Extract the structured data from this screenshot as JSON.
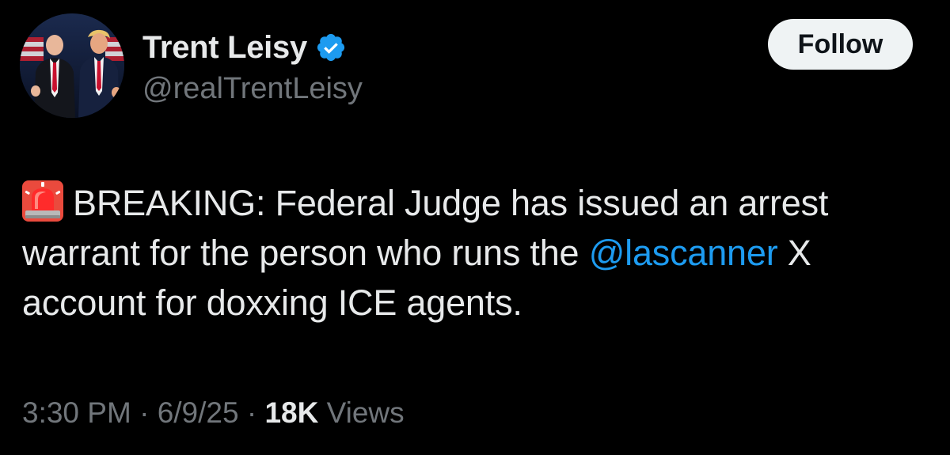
{
  "author": {
    "display_name": "Trent Leisy",
    "handle": "@realTrentLeisy",
    "verified": true,
    "avatar_icon": "profile-photo-two-men-flag-background"
  },
  "actions": {
    "follow_label": "Follow"
  },
  "tweet": {
    "siren_icon": "police-car-light-emoji",
    "text_before_mention": "BREAKING: Federal Judge has issued an arrest warrant for the person who runs the ",
    "mention": "@lascanner",
    "text_after_mention": " X account for doxxing ICE agents."
  },
  "meta": {
    "time": "3:30 PM",
    "separator": " · ",
    "date": "6/9/25",
    "views_count": "18K",
    "views_label": " Views"
  },
  "colors": {
    "background": "#000000",
    "text_primary": "#e7e9ea",
    "text_secondary": "#71767b",
    "link": "#1d9bf0",
    "verified_badge": "#1d9bf0",
    "follow_button_bg": "#eff3f4"
  }
}
